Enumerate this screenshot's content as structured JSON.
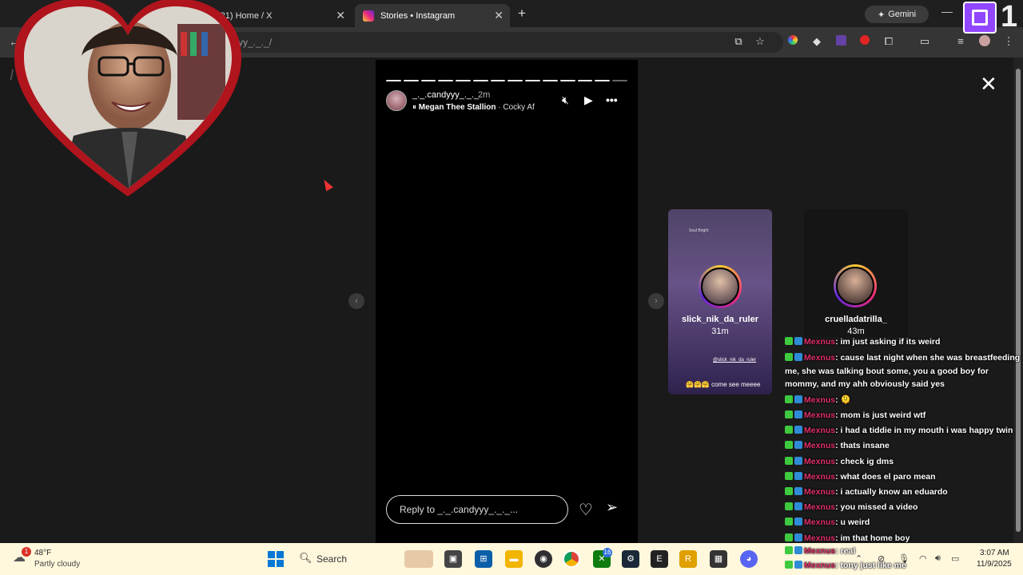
{
  "browser": {
    "tabs": [
      {
        "title": "(21) Home / X",
        "active": false
      },
      {
        "title": "Stories • Instagram",
        "active": true
      }
    ],
    "new_tab_symbol": "+",
    "close_symbol": "✕",
    "gemini_label": "Gemini",
    "url_fragment": "yy_._._/",
    "twitch_number": "1"
  },
  "instagram": {
    "logo_fragment": "I",
    "story": {
      "username": "_._.candyyy_._._",
      "time": "2m",
      "music_artist": "Megan Thee Stallion",
      "music_separator": " · ",
      "music_song": "Cocky Af",
      "progress_segments_total": 14,
      "progress_segments_viewed": 13
    },
    "reply_placeholder": "Reply to _._.candyyy_._._...",
    "next_stories": [
      {
        "username": "slick_nik_da_ruler",
        "time": "31m",
        "caption": "🤗🤗🤗 come see meeee",
        "tag": "@slick_nik_da_ruler",
        "header_text": "Soul Bright"
      },
      {
        "username": "cruelladatrilla_",
        "time": "43m"
      }
    ]
  },
  "chat": {
    "messages": [
      {
        "user": "Mexnus",
        "text": "im just asking if its weird"
      },
      {
        "user": "Mexnus",
        "text": "cause last night when she was breastfeeding me, she was talking bout some, you a good boy for mommy, and my ahh obviously said yes"
      },
      {
        "user": "Mexnus",
        "text": "🫠"
      },
      {
        "user": "Mexnus",
        "text": "mom is just weird wtf"
      },
      {
        "user": "Mexnus",
        "text": "i had a tiddie in my mouth i was happy twin"
      },
      {
        "user": "Mexnus",
        "text": "thats insane"
      },
      {
        "user": "Mexnus",
        "text": "check ig dms"
      },
      {
        "user": "Mexnus",
        "text": "what does el paro mean"
      },
      {
        "user": "Mexnus",
        "text": "i actually know an eduardo"
      },
      {
        "user": "Mexnus",
        "text": "you missed a video"
      },
      {
        "user": "Mexnus",
        "text": "u weird"
      },
      {
        "user": "Mexnus",
        "text": "im that home boy"
      },
      {
        "user": "Mexnus",
        "text": "real"
      },
      {
        "user": "Mexnus",
        "text": "tony just like me"
      }
    ],
    "separator": ": "
  },
  "taskbar": {
    "weather_temp": "48°F",
    "weather_desc": "Partly cloudy",
    "weather_badge": "1",
    "search_label": "Search",
    "xbox_badge": "16",
    "time": "3:07 AM",
    "date": "11/9/2025"
  },
  "colors": {
    "chat_username": "#e0306a",
    "twitch_purple": "#9146ff",
    "taskbar_bg": "#fff8dd"
  }
}
